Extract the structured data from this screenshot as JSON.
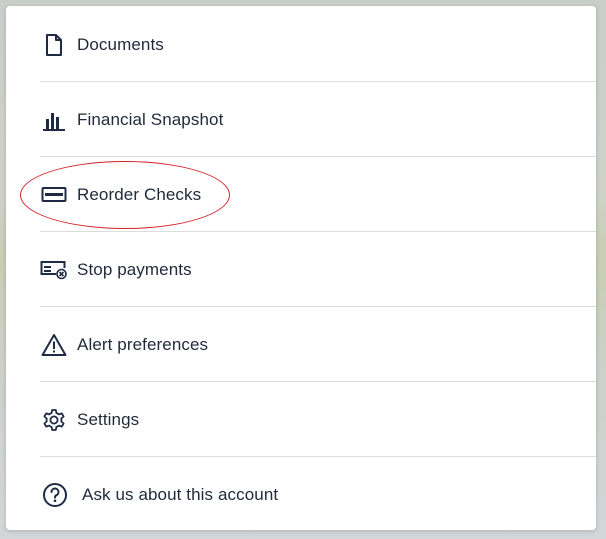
{
  "menu": {
    "items": [
      {
        "label": "Documents",
        "icon": "document-icon"
      },
      {
        "label": "Financial Snapshot",
        "icon": "bar-chart-icon"
      },
      {
        "label": "Reorder Checks",
        "icon": "check-icon"
      },
      {
        "label": "Stop payments",
        "icon": "stop-payment-icon"
      },
      {
        "label": "Alert preferences",
        "icon": "alert-icon"
      },
      {
        "label": "Settings",
        "icon": "gear-icon"
      },
      {
        "label": "Ask us about this account",
        "icon": "help-icon"
      }
    ]
  },
  "colors": {
    "icon": "#1f2a44",
    "text": "#1f2a3a",
    "divider": "#dcdcdc",
    "annotation": "#d42026"
  }
}
